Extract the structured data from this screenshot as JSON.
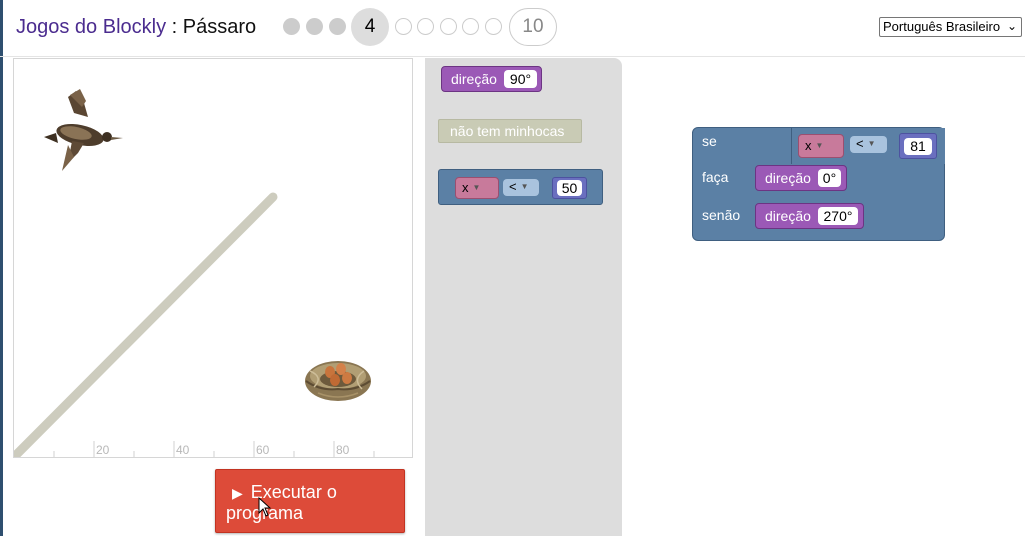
{
  "header": {
    "app_title": "Jogos do Blockly",
    "separator": ":",
    "level_name": "Pássaro",
    "current_level": "4",
    "last_level": "10",
    "language": "Português Brasileiro"
  },
  "visualization": {
    "axis_ticks": [
      "20",
      "40",
      "60",
      "80"
    ]
  },
  "run_button": {
    "label": "Executar o programa"
  },
  "toolbox": {
    "heading_block": {
      "label": "direção",
      "value": "90°"
    },
    "worm_block": {
      "label": "não tem minhocas"
    },
    "compare_block": {
      "variable": "x",
      "operator": "<",
      "value": "50"
    }
  },
  "workspace": {
    "if_block": {
      "if_label": "se",
      "do_label": "faça",
      "else_label": "senão",
      "condition": {
        "variable": "x",
        "operator": "<",
        "value": "81"
      },
      "do_heading": {
        "label": "direção",
        "value": "0°"
      },
      "else_heading": {
        "label": "direção",
        "value": "270°"
      }
    }
  },
  "colors": {
    "heading_block": "#9b59b6",
    "logic_block": "#5b80a5",
    "compare_field": "#c87a9b",
    "operator_field": "#a9c3de",
    "number_field": "#6a6fbf",
    "disabled_block": "#c9cbb5",
    "run_button": "#dd4b39",
    "wall": "#cdccbe"
  }
}
